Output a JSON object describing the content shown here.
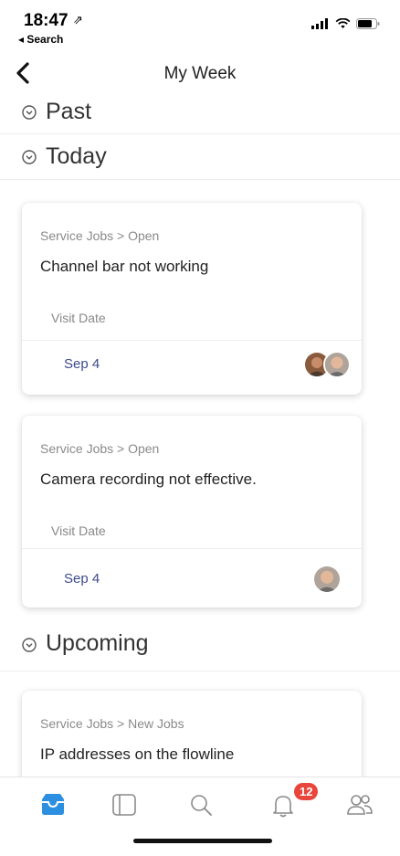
{
  "status_bar": {
    "time": "18:47",
    "location_glyph": "⇗",
    "back_app": "◂ Search"
  },
  "nav": {
    "title": "My Week"
  },
  "sections": {
    "past": "Past",
    "today": "Today",
    "upcoming": "Upcoming"
  },
  "cards": [
    {
      "breadcrumb": "Service Jobs > Open",
      "title": "Channel bar not working",
      "visit_label": "Visit Date",
      "date": "Sep 4"
    },
    {
      "breadcrumb": "Service Jobs > Open",
      "title": "Camera recording not effective.",
      "visit_label": "Visit Date",
      "date": "Sep 4"
    },
    {
      "breadcrumb": "Service Jobs > New Jobs",
      "title": "IP addresses on the flowline"
    }
  ],
  "tabbar": {
    "notifications_badge": "12",
    "icons": [
      "inbox-icon",
      "sidebar-icon",
      "search-icon",
      "bell-icon",
      "people-icon"
    ]
  },
  "colors": {
    "accent": "#2d8fe0",
    "date_text": "#3d4a8c",
    "badge": "#e8453c"
  }
}
